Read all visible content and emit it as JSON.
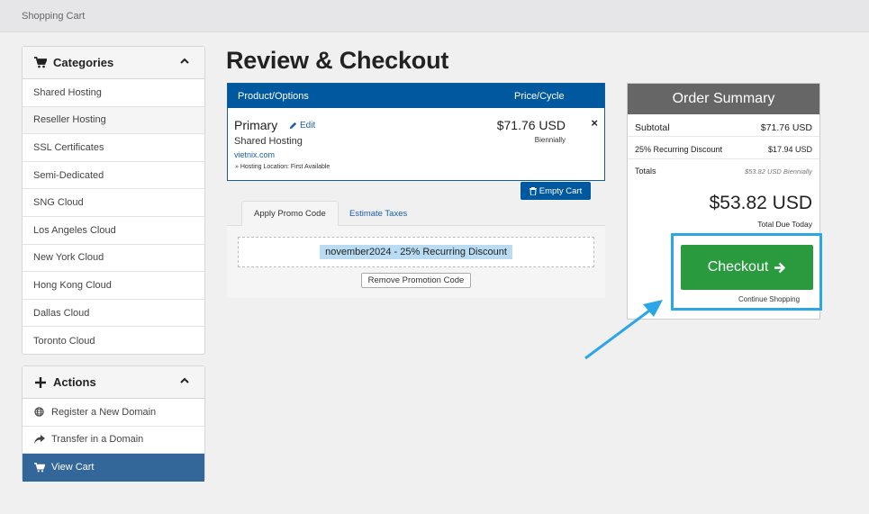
{
  "breadcrumb": "Shopping Cart",
  "page_title": "Review & Checkout",
  "categories": {
    "title": "Categories",
    "items": [
      {
        "label": "Shared Hosting"
      },
      {
        "label": "Reseller Hosting"
      },
      {
        "label": "SSL Certificates"
      },
      {
        "label": "Semi-Dedicated"
      },
      {
        "label": "SNG Cloud"
      },
      {
        "label": "Los Angeles Cloud"
      },
      {
        "label": "New York Cloud"
      },
      {
        "label": "Hong Kong Cloud"
      },
      {
        "label": "Dallas Cloud"
      },
      {
        "label": "Toronto Cloud"
      }
    ]
  },
  "actions": {
    "title": "Actions",
    "items": [
      {
        "label": "Register a New Domain",
        "icon": "globe-icon"
      },
      {
        "label": "Transfer in a Domain",
        "icon": "share-arrow-icon"
      },
      {
        "label": "View Cart",
        "icon": "cart-icon"
      }
    ]
  },
  "cart": {
    "col_product": "Product/Options",
    "col_price": "Price/Cycle",
    "item": {
      "name": "Primary",
      "edit_label": "Edit",
      "type": "Shared Hosting",
      "domain": "vietnix.com",
      "location": "» Hosting Location: First Available",
      "price": "$71.76 USD",
      "cycle": "Biennially",
      "remove": "×"
    },
    "empty_label": "Empty Cart"
  },
  "promo": {
    "tab_apply": "Apply Promo Code",
    "tab_taxes": "Estimate Taxes",
    "applied": "november2024 - 25% Recurring Discount",
    "remove_label": "Remove Promotion Code"
  },
  "summary": {
    "title": "Order Summary",
    "subtotal_label": "Subtotal",
    "subtotal_value": "$71.76 USD",
    "discount_label": "25% Recurring Discount",
    "discount_value": "$17.94 USD",
    "totals_label": "Totals",
    "totals_value": "$53.82 USD Biennially",
    "total_due": "$53.82 USD",
    "total_due_label": "Total Due Today",
    "checkout_label": "Checkout",
    "continue_label": "Continue Shopping"
  },
  "colors": {
    "primary": "#00589e",
    "checkout": "#2a9a3f",
    "highlight": "#2ba6e8",
    "active_nav": "#336699"
  }
}
